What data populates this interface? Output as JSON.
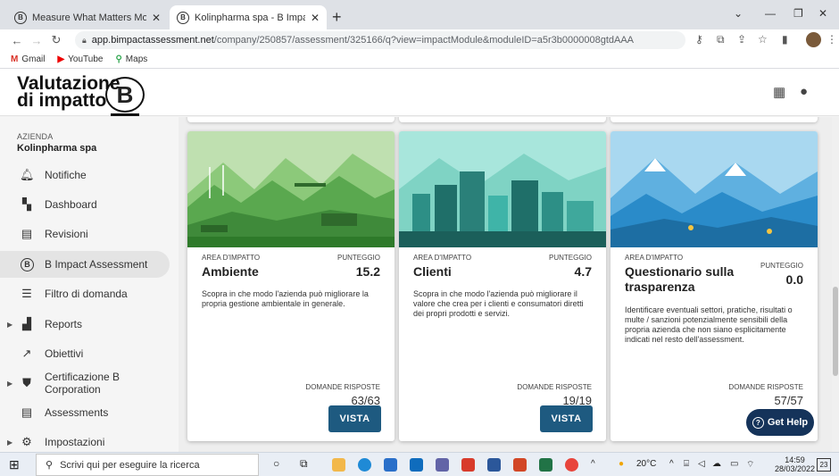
{
  "browser": {
    "tabs": [
      {
        "title": "Measure What Matters Most | E",
        "favicon": "B",
        "active": false
      },
      {
        "title": "Kolinpharma spa - B Impact Asse",
        "favicon": "B",
        "active": true
      }
    ],
    "url_host": "app.bimpactassessment.net",
    "url_path": "/company/250857/assessment/325166/q?view=impactModule&moduleID=a5r3b0000008gtdAAA",
    "bookmarks": [
      {
        "label": "Gmail",
        "icon": "gmail-icon"
      },
      {
        "label": "YouTube",
        "icon": "youtube-icon"
      },
      {
        "label": "Maps",
        "icon": "maps-icon"
      }
    ]
  },
  "app": {
    "logo_line1": "Valutazione",
    "logo_line2": "di impatto",
    "logo_mark": "B"
  },
  "sidebar": {
    "company_label": "AZIENDA",
    "company_name": "Kolinpharma spa",
    "items": [
      {
        "label": "Notifiche",
        "icon": "bell-icon",
        "expandable": false,
        "selected": false
      },
      {
        "label": "Dashboard",
        "icon": "dashboard-icon",
        "expandable": false,
        "selected": false
      },
      {
        "label": "Revisioni",
        "icon": "review-icon",
        "expandable": false,
        "selected": false
      },
      {
        "label": "B Impact Assessment",
        "icon": "b-icon",
        "expandable": false,
        "selected": true
      },
      {
        "label": "Filtro di domanda",
        "icon": "filter-icon",
        "expandable": false,
        "selected": false
      },
      {
        "label": "Reports",
        "icon": "bar-chart-icon",
        "expandable": true,
        "selected": false
      },
      {
        "label": "Obiettivi",
        "icon": "trend-icon",
        "expandable": false,
        "selected": false
      },
      {
        "label": "Certificazione B Corporation",
        "icon": "shield-icon",
        "expandable": true,
        "selected": false
      },
      {
        "label": "Assessments",
        "icon": "list-icon",
        "expandable": false,
        "selected": false
      },
      {
        "label": "Impostazioni",
        "icon": "gear-icon",
        "expandable": true,
        "selected": false
      }
    ]
  },
  "cards": [
    {
      "area_label": "AREA D'IMPATTO",
      "name": "Ambiente",
      "score_label": "PUNTEGGIO",
      "score": "15.2",
      "description": "Scopra in che modo l'azienda può migliorare la propria gestione ambientale in generale.",
      "answers_label": "DOMANDE RISPOSTE",
      "answers": "63/63",
      "button": "VISTA",
      "theme": "green"
    },
    {
      "area_label": "AREA D'IMPATTO",
      "name": "Clienti",
      "score_label": "PUNTEGGIO",
      "score": "4.7",
      "description": "Scopra in che modo l'azienda può migliorare il valore che crea per i clienti e consumatori diretti dei propri prodotti e servizi.",
      "answers_label": "DOMANDE RISPOSTE",
      "answers": "19/19",
      "button": "VISTA",
      "theme": "teal"
    },
    {
      "area_label": "AREA D'IMPATTO",
      "name_line1": "Questionario sulla",
      "name_line2": "trasparenza",
      "score_label": "PUNTEGGIO",
      "score": "0.0",
      "description": "Identificare eventuali settori, pratiche, risultati o multe / sanzioni potenzialmente sensibili della propria azienda che non siano esplicitamente indicati nel resto dell'assessment.",
      "answers_label": "DOMANDE RISPOSTE",
      "answers": "57/57",
      "theme": "blue"
    }
  ],
  "help_button": "Get Help",
  "taskbar": {
    "search_placeholder": "Scrivi qui per eseguire la ricerca",
    "weather": "20°C",
    "time": "14:59",
    "date": "28/03/2022",
    "notifications": "23"
  },
  "colors": {
    "primary_button": "#1e5a80",
    "help_button": "#15335a",
    "green_theme": "#5aa84f",
    "teal_theme": "#3fb4a8",
    "blue_theme": "#2a8bc9"
  }
}
